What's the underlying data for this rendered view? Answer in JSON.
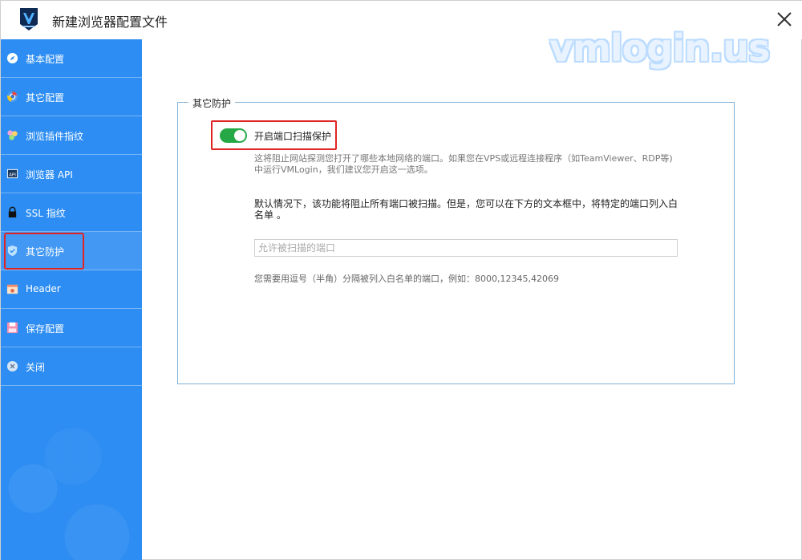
{
  "window": {
    "title": "新建浏览器配置文件"
  },
  "watermark": "vmlogin.us",
  "sidebar": {
    "items": [
      {
        "label": "基本配置",
        "icon": "compass-icon"
      },
      {
        "label": "其它配置",
        "icon": "chrome-icon"
      },
      {
        "label": "浏览插件指纹",
        "icon": "puzzle-icon"
      },
      {
        "label": "浏览器 API",
        "icon": "api-icon"
      },
      {
        "label": "SSL 指纹",
        "icon": "lock-icon"
      },
      {
        "label": "其它防护",
        "icon": "shield-icon",
        "active": true
      },
      {
        "label": "Header",
        "icon": "header-icon"
      },
      {
        "label": "保存配置",
        "icon": "save-icon"
      },
      {
        "label": "关闭",
        "icon": "close-circle-icon"
      }
    ]
  },
  "main": {
    "group_title": "其它防护",
    "toggle": {
      "label": "开启端口扫描保护",
      "on": true
    },
    "description": "这将阻止网站探测您打开了哪些本地网络的端口。如果您在VPS或远程连接程序（如TeamViewer、RDP等)中运行VMLogin，我们建议您开启这一选项。",
    "default_text": "默认情况下，该功能将阻止所有端口被扫描。但是，您可以在下方的文本框中，将特定的端口列入白名单 。",
    "port_input": {
      "placeholder": "允许被扫描的端口",
      "value": ""
    },
    "hint": "您需要用逗号（半角）分隔被列入白名单的端口，例如：8000,12345,42069"
  },
  "colors": {
    "sidebar": "#2d8df2",
    "toggle_on": "#27a847",
    "highlight": "#e02424",
    "group_border": "#7fb0d6"
  }
}
